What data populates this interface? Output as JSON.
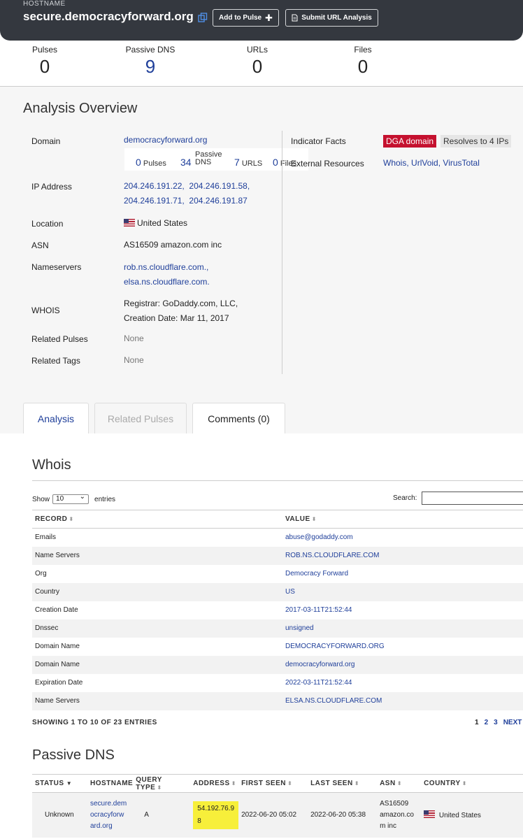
{
  "header": {
    "label": "HOSTNAME",
    "hostname": "secure.democracyforward.org",
    "add_pulse": "Add to Pulse",
    "add_pulse_icon": "plus-icon",
    "submit_url": "Submit URL Analysis",
    "submit_icon": "document-icon"
  },
  "stats": [
    {
      "label": "Pulses",
      "value": "0"
    },
    {
      "label": "Passive DNS",
      "value": "9"
    },
    {
      "label": "URLs",
      "value": "0"
    },
    {
      "label": "Files",
      "value": "0"
    }
  ],
  "overview": {
    "title": "Analysis Overview",
    "domain_label": "Domain",
    "domain": "democracyforward.org",
    "mini": {
      "pulses_val": "0",
      "pulses_lbl": "Pulses",
      "dns_val": "34",
      "dns_lbl1": "Passive",
      "dns_lbl2": "DNS",
      "urls_val": "7",
      "urls_lbl": "URLS",
      "files_val": "0",
      "files_lbl": "Files"
    },
    "ip_label": "IP Address",
    "ips": [
      "204.246.191.22,",
      "204.246.191.58,",
      "204.246.191.71,",
      "204.246.191.87"
    ],
    "location_label": "Location",
    "location": "United States",
    "asn_label": "ASN",
    "asn": "AS16509 amazon.com inc",
    "ns_label": "Nameservers",
    "ns": [
      "rob.ns.cloudflare.com.,",
      "elsa.ns.cloudflare.com."
    ],
    "whois_label": "WHOIS",
    "whois1": "Registrar: GoDaddy.com, LLC,",
    "whois2": "Creation Date: Mar 11, 2017",
    "related_pulses_label": "Related Pulses",
    "related_pulses": "None",
    "related_tags_label": "Related Tags",
    "related_tags": "None",
    "indicator_label": "Indicator Facts",
    "tag_dga": "DGA domain",
    "tag_resolves": "Resolves to 4 IPs",
    "external_label": "External Resources",
    "ext_whois": "Whois,",
    "ext_urlvoid": "UrlVoid,",
    "ext_vt": "VirusTotal"
  },
  "tabs": [
    "Analysis",
    "Related Pulses",
    "Comments (0)"
  ],
  "whois": {
    "title": "Whois",
    "show": "Show",
    "entries_sel": "10",
    "entries": "entries",
    "search": "Search:",
    "col_record": "RECORD",
    "col_value": "VALUE",
    "rows": [
      [
        "Emails",
        "abuse@godaddy.com"
      ],
      [
        "Name Servers",
        "ROB.NS.CLOUDFLARE.COM"
      ],
      [
        "Org",
        "Democracy Forward"
      ],
      [
        "Country",
        "US"
      ],
      [
        "Creation Date",
        "2017-03-11T21:52:44"
      ],
      [
        "Dnssec",
        "unsigned"
      ],
      [
        "Domain Name",
        "DEMOCRACYFORWARD.ORG"
      ],
      [
        "Domain Name",
        "democracyforward.org"
      ],
      [
        "Expiration Date",
        "2022-03-11T21:52:44"
      ],
      [
        "Name Servers",
        "ELSA.NS.CLOUDFLARE.COM"
      ]
    ],
    "showing": "SHOWING 1 TO 10 OF 23 ENTRIES",
    "pages": [
      "1",
      "2",
      "3",
      "NEXT"
    ]
  },
  "passive_dns": {
    "title": "Passive DNS",
    "cols": [
      "STATUS",
      "HOSTNAME",
      "QUERY TYPE",
      "ADDRESS",
      "FIRST SEEN",
      "LAST SEEN",
      "ASN",
      "COUNTRY"
    ],
    "row": {
      "status": "Unknown",
      "hostname_lines": [
        "secure.dem",
        "ocracyforw",
        "ard.org"
      ],
      "qtype": "A",
      "address_lines": [
        "54.192.76.9",
        "8"
      ],
      "first": "2022-06-20 05:02",
      "last": "2022-06-20 05:38",
      "asn_lines": [
        "AS16509",
        "amazon.co",
        "m inc"
      ],
      "country": "United States"
    }
  }
}
